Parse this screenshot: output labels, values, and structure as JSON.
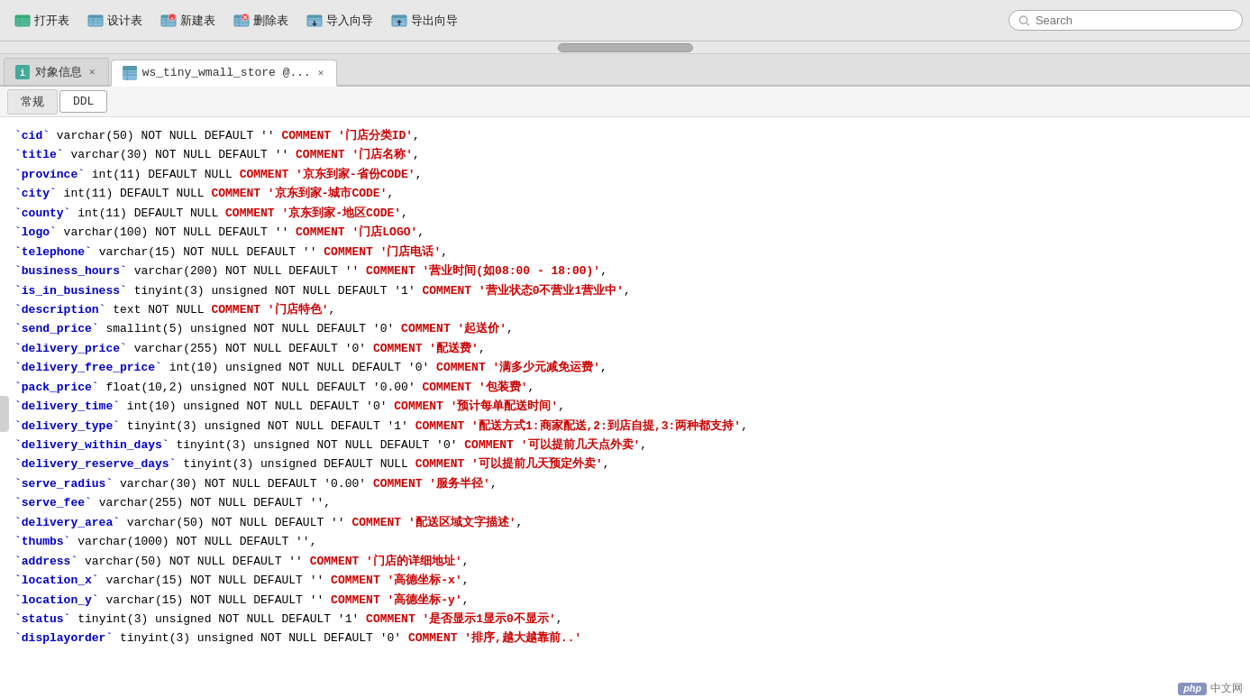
{
  "toolbar": {
    "buttons": [
      {
        "id": "open-table",
        "label": "打开表",
        "icon": "table-open"
      },
      {
        "id": "design-table",
        "label": "设计表",
        "icon": "table-design"
      },
      {
        "id": "new-table",
        "label": "新建表",
        "icon": "table-new"
      },
      {
        "id": "delete-table",
        "label": "删除表",
        "icon": "table-delete"
      },
      {
        "id": "import-wizard",
        "label": "导入向导",
        "icon": "import"
      },
      {
        "id": "export-wizard",
        "label": "导出向导",
        "icon": "export"
      }
    ],
    "search_placeholder": "Search"
  },
  "tabs": [
    {
      "id": "object-info",
      "label": "对象信息",
      "icon": "obj",
      "active": false,
      "closable": true
    },
    {
      "id": "table-ddl",
      "label": "ws_tiny_wmall_store @...",
      "icon": "tbl",
      "active": true,
      "closable": true
    }
  ],
  "sub_tabs": [
    {
      "id": "general",
      "label": "常规",
      "active": false
    },
    {
      "id": "ddl",
      "label": "DDL",
      "active": true
    }
  ],
  "ddl_content": [
    "`cid` varchar(50) NOT NULL DEFAULT '' COMMENT '门店分类ID',",
    "`title` varchar(30) NOT NULL DEFAULT '' COMMENT '门店名称',",
    "`province` int(11) DEFAULT NULL COMMENT '京东到家-省份CODE',",
    "`city` int(11) DEFAULT NULL COMMENT '京东到家-城市CODE',",
    "`county` int(11) DEFAULT NULL COMMENT '京东到家-地区CODE',",
    "`logo` varchar(100) NOT NULL DEFAULT '' COMMENT '门店LOGO',",
    "`telephone` varchar(15) NOT NULL DEFAULT '' COMMENT '门店电话',",
    "`business_hours` varchar(200) NOT NULL DEFAULT '' COMMENT '营业时间(如08:00 - 18:00)',",
    "`is_in_business` tinyint(3) unsigned NOT NULL DEFAULT '1' COMMENT '营业状态0不营业1营业中',",
    "`description` text NOT NULL COMMENT '门店特色',",
    "`send_price` smallint(5) unsigned NOT NULL DEFAULT '0' COMMENT '起送价',",
    "`delivery_price` varchar(255) NOT NULL DEFAULT '0' COMMENT '配送费',",
    "`delivery_free_price` int(10) unsigned NOT NULL DEFAULT '0' COMMENT '满多少元减免运费',",
    "`pack_price` float(10,2) unsigned NOT NULL DEFAULT '0.00' COMMENT '包装费',",
    "`delivery_time` int(10) unsigned NOT NULL DEFAULT '0' COMMENT '预计每单配送时间',",
    "`delivery_type` tinyint(3) unsigned NOT NULL DEFAULT '1' COMMENT '配送方式1:商家配送,2:到店自提,3:两种都支持',",
    "`delivery_within_days` tinyint(3) unsigned NOT NULL DEFAULT '0' COMMENT '可以提前几天点外卖',",
    "`delivery_reserve_days` tinyint(3) unsigned DEFAULT NULL COMMENT '可以提前几天预定外卖',",
    "`serve_radius` varchar(30) NOT NULL DEFAULT '0.00' COMMENT '服务半径',",
    "`serve_fee` varchar(255) NOT NULL DEFAULT '',",
    "`delivery_area` varchar(50) NOT NULL DEFAULT '' COMMENT '配送区域文字描述',",
    "`thumbs` varchar(1000) NOT NULL DEFAULT '',",
    "`address` varchar(50) NOT NULL DEFAULT '' COMMENT '门店的详细地址',",
    "`location_x` varchar(15) NOT NULL DEFAULT '' COMMENT '高德坐标-x',",
    "`location_y` varchar(15) NOT NULL DEFAULT '' COMMENT '高德坐标-y',",
    "`status` tinyint(3) unsigned NOT NULL DEFAULT '1' COMMENT '是否显示1显示0不显示',",
    "`displayorder` tinyint(3) unsigned NOT NULL DEFAULT '0' COMMENT '排序,越大越靠前..'"
  ],
  "bottom": {
    "php_badge": "php",
    "php_text": "中文网"
  }
}
